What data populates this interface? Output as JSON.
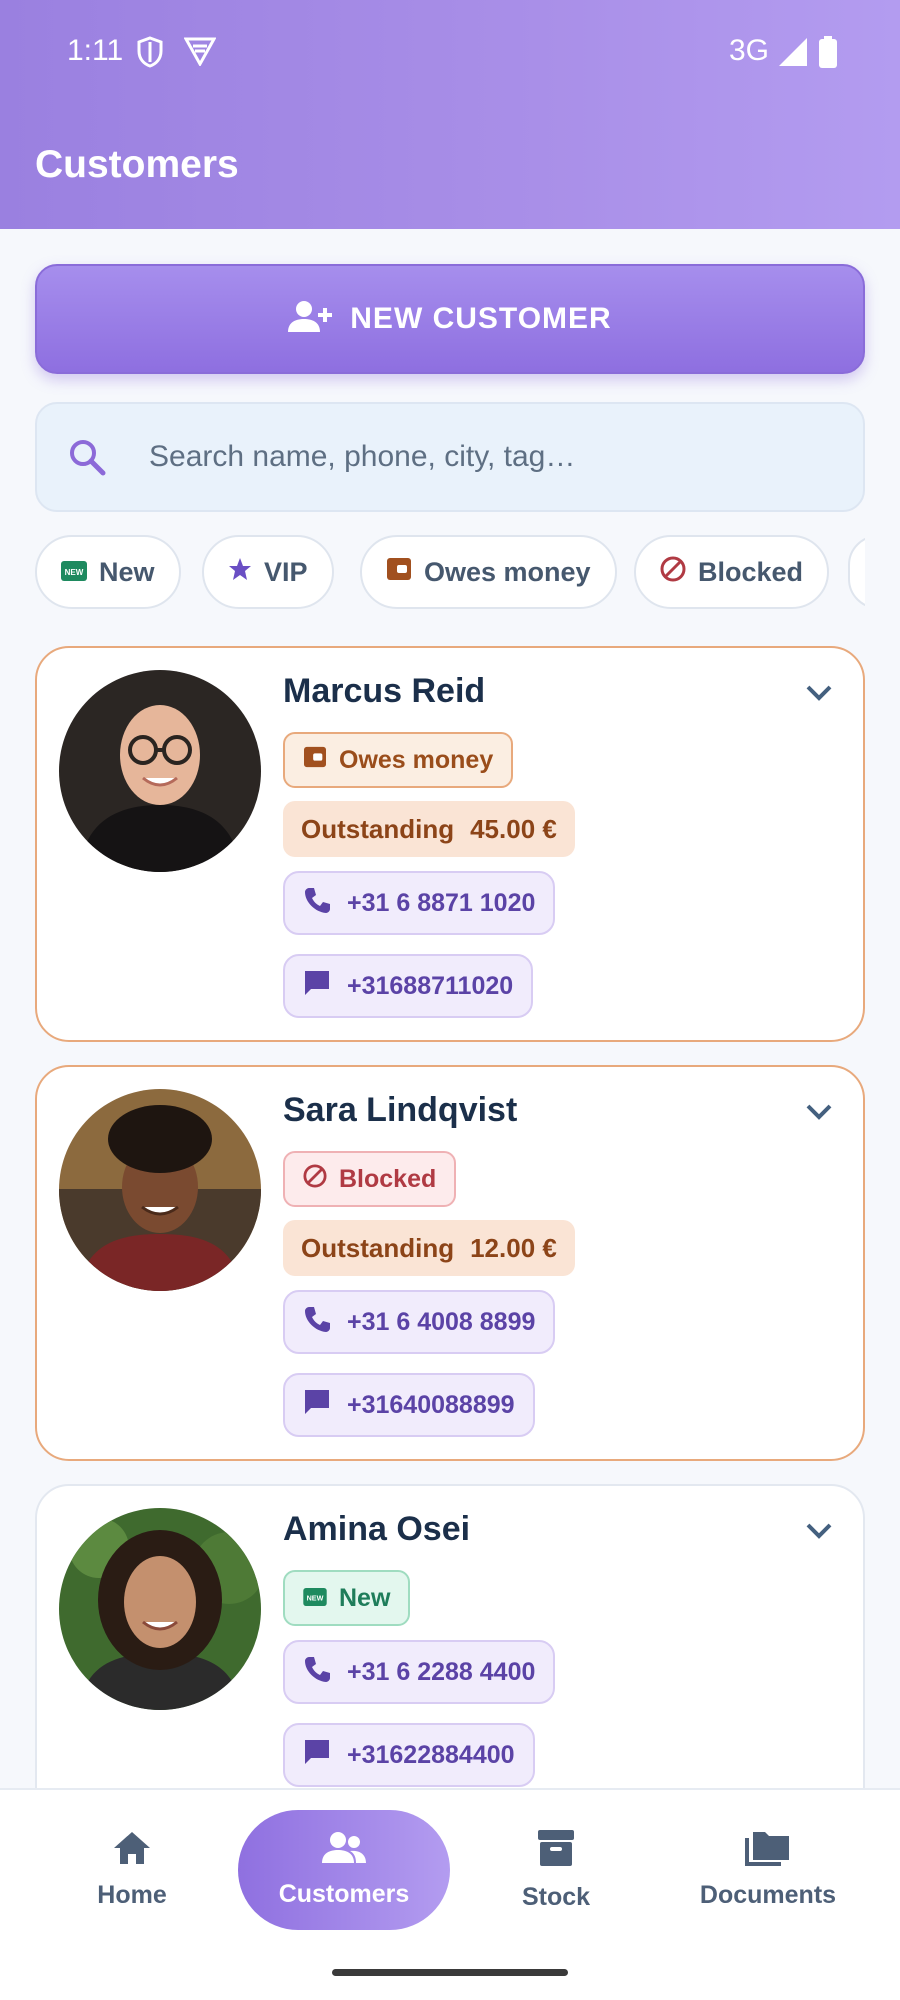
{
  "status_bar": {
    "time": "1:11",
    "network": "3G"
  },
  "header": {
    "title": "Customers"
  },
  "actions": {
    "new_customer_label": "NEW CUSTOMER"
  },
  "search": {
    "placeholder": "Search name, phone, city, tag…"
  },
  "filters": [
    {
      "label": "New",
      "icon": "new-badge-icon"
    },
    {
      "label": "VIP",
      "icon": "star-icon"
    },
    {
      "label": "Owes money",
      "icon": "wallet-icon"
    },
    {
      "label": "Blocked",
      "icon": "blocked-icon"
    }
  ],
  "customers": [
    {
      "name": "Marcus Reid",
      "tag": "Owes money",
      "outstanding_label": "Outstanding",
      "outstanding_amount": "45.00 €",
      "phone": "+31 6 8871 1020",
      "message": "+31688711020"
    },
    {
      "name": "Sara Lindqvist",
      "tag": "Blocked",
      "outstanding_label": "Outstanding",
      "outstanding_amount": "12.00 €",
      "phone": "+31 6 4008 8899",
      "message": "+31640088899"
    },
    {
      "name": "Amina Osei",
      "tag": "New",
      "phone": "+31 6 2288 4400",
      "message": "+31622884400"
    }
  ],
  "nav": [
    {
      "label": "Home",
      "icon": "home-icon"
    },
    {
      "label": "Customers",
      "icon": "people-icon"
    },
    {
      "label": "Stock",
      "icon": "archive-icon"
    },
    {
      "label": "Documents",
      "icon": "folders-icon"
    }
  ],
  "colors": {
    "accent": "#9a80e0",
    "owes": "#9a4d1b",
    "blocked": "#b03a43",
    "new": "#1e7d5a",
    "contact": "#5b43a6"
  }
}
